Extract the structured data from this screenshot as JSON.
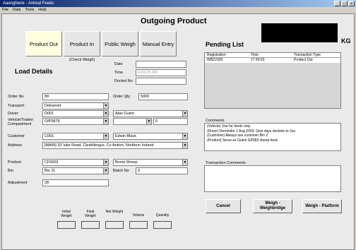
{
  "window": {
    "title": "Aaenghene - Animal Feeds",
    "controls": [
      "_",
      "□",
      "×"
    ]
  },
  "menu": [
    "File",
    "Data",
    "Tools",
    "Help"
  ],
  "page_title": "Outgoing Product",
  "tabs": [
    {
      "label": "Product Out",
      "active": true
    },
    {
      "label": "Product In",
      "active": false
    },
    {
      "label": "Public Weigh",
      "active": false
    },
    {
      "label": "Manual Entry",
      "active": false
    }
  ],
  "check_weigh_label": "(Check Weigh)",
  "load_details": {
    "title": "Load Details",
    "date_label": "Date",
    "date_value": "",
    "time_label": "Time",
    "time_value": "EO4:25 AM",
    "docket_label": "Docket No",
    "docket_value": ""
  },
  "order": {
    "order_no_label": "Order No",
    "order_no_value": "89",
    "order_qty_label": "Order Qty",
    "order_qty_value": "5000",
    "transport_label": "Transport",
    "transport_value": "Delivered",
    "driver_label": "Driver",
    "driver_code": "D001",
    "driver_name": "Alan Guinn",
    "vehicle_label": "Vehicle/Trailer/ Compartment",
    "vehicle_value": "OIP5876",
    "trailer_value": "",
    "compartment_value": "6",
    "customer_label": "Customer",
    "customer_code": "C001",
    "customer_name": "Edwin Black",
    "address_label": "Address",
    "address_value": "[MAIN] 33 Vale Road, Clerkillergus, Co Antrim, Northern Ireland",
    "product_label": "Product",
    "product_code": "CF0002",
    "product_name": "Boost Sheep",
    "bin_label": "Bin",
    "bin_value": "Bin 11",
    "batch_label": "Batch No",
    "batch_value": "0",
    "adjustment_label": "Adjustment",
    "adjustment_value": "28"
  },
  "weights": {
    "labels": [
      "Initial Weight",
      "Final Weight",
      "Net Weight",
      "Volume",
      "Quantity"
    ]
  },
  "kg_label": "KG",
  "pending": {
    "title": "Pending List",
    "columns": [
      "Registration",
      "Time",
      "Transaction Type"
    ],
    "rows": [
      {
        "registration": "WBZ2339",
        "time": "17:43:53",
        "type": "Product Out"
      }
    ]
  },
  "comments": {
    "label": "Comments",
    "lines": [
      "(Vehicle) Use for feeds only.",
      "(Driver) Reminder 1 Aug 2003: Give days dockets to Joe.",
      "(Customer) Always use customer Bin 2",
      "(Product) Serve ex Guinn GP583 sheep feed."
    ]
  },
  "transaction_comments": {
    "label": "Transaction Comments",
    "value": ""
  },
  "buttons": {
    "cancel": "Cancel",
    "weighbridge": "Weigh - Weighbridge",
    "platform": "Weigh - Platform"
  },
  "colors": {
    "title_bar": "#0a246a",
    "active_tab": "#ffffe0",
    "form_bg": "#eaeaea",
    "kg_display": "#000000"
  }
}
